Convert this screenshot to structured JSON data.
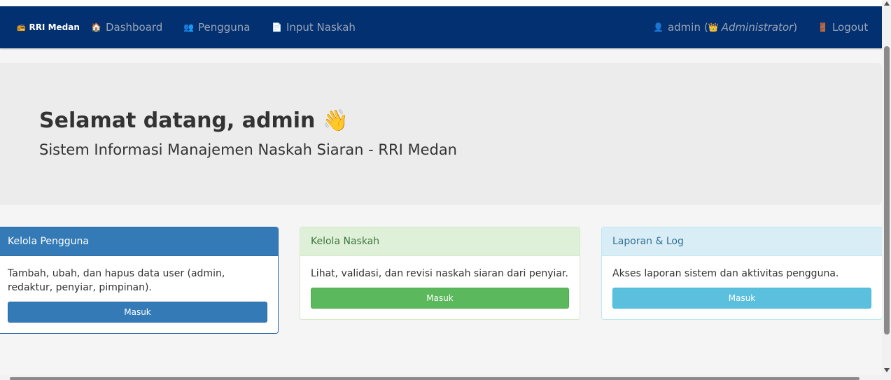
{
  "navbar": {
    "brand": "RRI Medan",
    "brand_icon": "📻",
    "items": [
      {
        "icon": "🏠",
        "label": "Dashboard"
      },
      {
        "icon": "👥",
        "label": "Pengguna"
      },
      {
        "icon": "📄",
        "label": "Input Naskah"
      }
    ],
    "user": {
      "icon": "👤",
      "name": "admin",
      "role_icon": "👑",
      "role": "Administrator"
    },
    "logout": {
      "icon": "🚪",
      "label": "Logout"
    },
    "bg_color": "#023070"
  },
  "hero": {
    "title": "Selamat datang, admin",
    "wave": "👋",
    "subtitle": "Sistem Informasi Manajemen Naskah Siaran - RRI Medan"
  },
  "cards": [
    {
      "title": "Kelola Pengguna",
      "description": "Tambah, ubah, dan hapus data user (admin, redaktur, penyiar, pimpinan).",
      "button": "Masuk",
      "color": "#337ab7"
    },
    {
      "title": "Kelola Naskah",
      "description": "Lihat, validasi, dan revisi naskah siaran dari penyiar.",
      "button": "Masuk",
      "color": "#5cb85c"
    },
    {
      "title": "Laporan & Log",
      "description": "Akses laporan sistem dan aktivitas pengguna.",
      "button": "Masuk",
      "color": "#5bc0de"
    }
  ]
}
